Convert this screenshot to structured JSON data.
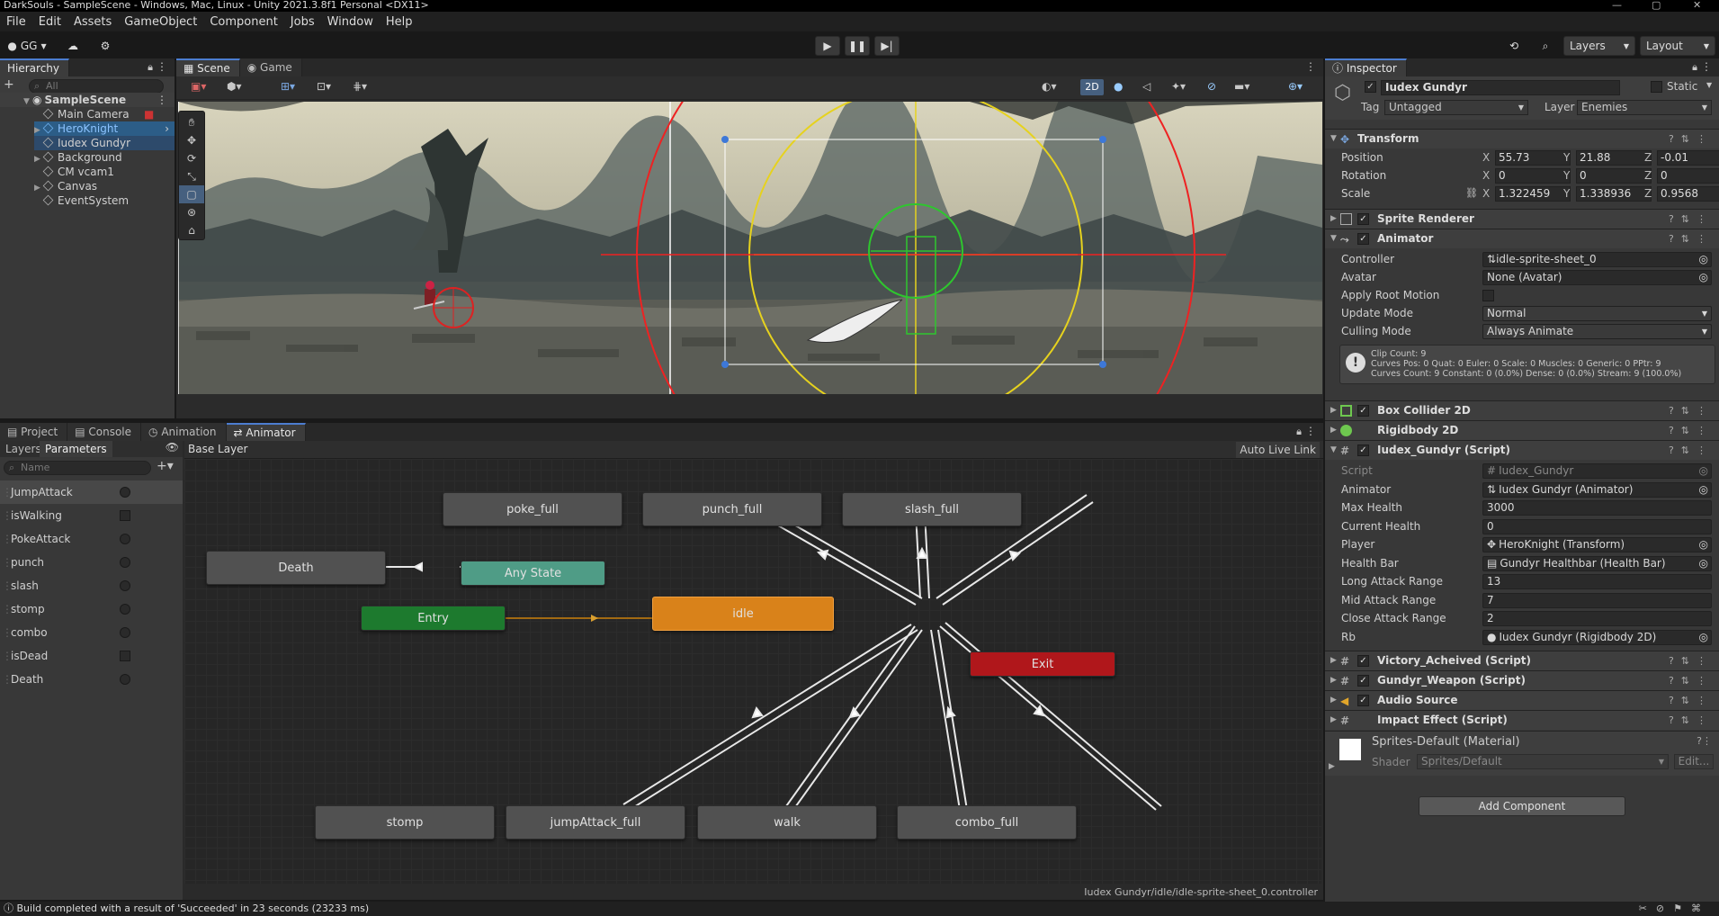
{
  "window": {
    "title": "DarkSouls - SampleScene - Windows, Mac, Linux - Unity 2021.3.8f1 Personal <DX11>"
  },
  "menu": [
    "File",
    "Edit",
    "Assets",
    "GameObject",
    "Component",
    "Jobs",
    "Window",
    "Help"
  ],
  "toolbar": {
    "account": "GG",
    "layers": "Layers",
    "layout": "Layout"
  },
  "hierarchy": {
    "tab": "Hierarchy",
    "search_placeholder": "All",
    "add_label": "+",
    "scene": "SampleScene",
    "items": [
      "Main Camera",
      "HeroKnight",
      "Iudex Gundyr",
      "Background",
      "CM vcam1",
      "Canvas",
      "EventSystem"
    ]
  },
  "scene_tabs": {
    "scene": "Scene",
    "game": "Game",
    "mode_2d": "2D"
  },
  "bottom_tabs": {
    "project": "Project",
    "console": "Console",
    "animation": "Animation",
    "animator": "Animator"
  },
  "animator": {
    "layers_tab": "Layers",
    "params_tab": "Parameters",
    "base_layer": "Base Layer",
    "auto_live_link": "Auto Live Link",
    "search_placeholder": "Name",
    "params": [
      {
        "name": "JumpAttack",
        "type": "trigger"
      },
      {
        "name": "isWalking",
        "type": "bool"
      },
      {
        "name": "PokeAttack",
        "type": "trigger"
      },
      {
        "name": "punch",
        "type": "trigger"
      },
      {
        "name": "slash",
        "type": "trigger"
      },
      {
        "name": "stomp",
        "type": "trigger"
      },
      {
        "name": "combo",
        "type": "trigger"
      },
      {
        "name": "isDead",
        "type": "bool"
      },
      {
        "name": "Death",
        "type": "trigger"
      }
    ],
    "states": {
      "poke": "poke_full",
      "punch": "punch_full",
      "slash": "slash_full",
      "death": "Death",
      "any": "Any State",
      "entry": "Entry",
      "idle": "idle",
      "exit": "Exit",
      "stomp": "stomp",
      "jump": "jumpAttack_full",
      "walk": "walk",
      "combo": "combo_full"
    },
    "path": "Iudex Gundyr/idle/idle-sprite-sheet_0.controller"
  },
  "inspector": {
    "tab": "Inspector",
    "object_name": "Iudex Gundyr",
    "static_label": "Static",
    "tag_label": "Tag",
    "tag": "Untagged",
    "layer_label": "Layer",
    "layer": "Enemies",
    "transform": {
      "title": "Transform",
      "position_label": "Position",
      "position": [
        "55.73",
        "21.88",
        "-0.01"
      ],
      "rotation_label": "Rotation",
      "rotation": [
        "0",
        "0",
        "0"
      ],
      "scale_label": "Scale",
      "scale": [
        "1.322459",
        "1.338936",
        "0.9568"
      ]
    },
    "sprite_renderer": "Sprite Renderer",
    "animator_comp": {
      "title": "Animator",
      "controller_label": "Controller",
      "controller": "idle-sprite-sheet_0",
      "avatar_label": "Avatar",
      "avatar": "None (Avatar)",
      "root_motion_label": "Apply Root Motion",
      "update_label": "Update Mode",
      "update": "Normal",
      "culling_label": "Culling Mode",
      "culling": "Always Animate",
      "info1": "Clip Count: 9",
      "info2": "Curves Pos: 0 Quat: 0 Euler: 0 Scale: 0 Muscles: 0 Generic: 0 PPtr: 9",
      "info3": "Curves Count: 9 Constant: 0 (0.0%) Dense: 0 (0.0%) Stream: 9 (100.0%)"
    },
    "box_collider": "Box Collider 2D",
    "rigidbody": "Rigidbody 2D",
    "script": {
      "title": "Iudex_Gundyr (Script)",
      "rows": [
        {
          "label": "Script",
          "value": "Iudex_Gundyr"
        },
        {
          "label": "Animator",
          "value": "Iudex Gundyr (Animator)"
        },
        {
          "label": "Max Health",
          "value": "3000"
        },
        {
          "label": "Current Health",
          "value": "0"
        },
        {
          "label": "Player",
          "value": "HeroKnight (Transform)"
        },
        {
          "label": "Health Bar",
          "value": "Gundyr Healthbar (Health Bar)"
        },
        {
          "label": "Long Attack Range",
          "value": "13"
        },
        {
          "label": "Mid Attack Range",
          "value": "7"
        },
        {
          "label": "Close Attack Range",
          "value": "2"
        },
        {
          "label": "Rb",
          "value": "Iudex Gundyr (Rigidbody 2D)"
        }
      ]
    },
    "victory": "Victory_Acheived (Script)",
    "weapon": "Gundyr_Weapon (Script)",
    "audio": "Audio Source",
    "impact": "Impact Effect (Script)",
    "material": "Sprites-Default (Material)",
    "shader_label": "Shader",
    "shader": "Sprites/Default",
    "edit": "Edit...",
    "add_component": "Add Component"
  },
  "status": "Build completed with a result of 'Succeeded' in 23 seconds (23233 ms)",
  "colors": {
    "accent": "#4c7dd0",
    "idle": "#d9821a",
    "entry": "#1d7a2e",
    "any": "#4f9c86",
    "exit": "#b0171b"
  }
}
